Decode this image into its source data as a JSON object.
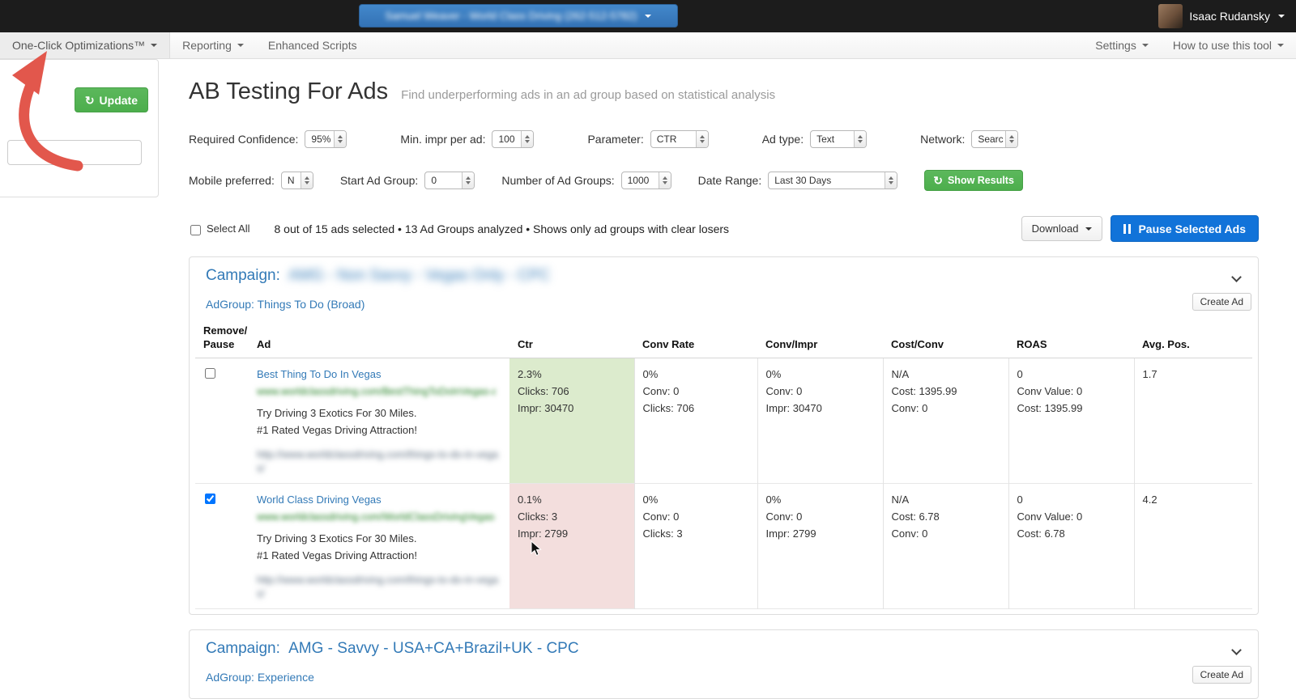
{
  "colors": {
    "accent_green": "#5cb85c",
    "link_blue": "#337ab7",
    "pause_blue": "#1173d9",
    "good_cell_bg": "#dcebcd",
    "bad_cell_bg": "#f3dedd",
    "arrow_red": "#e2574c"
  },
  "topbar": {
    "account_label": "Samuel Weaver - World Class Driving (262-512-5782)",
    "user_name": "Isaac Rudansky"
  },
  "nav": {
    "items": [
      {
        "label": "One-Click Optimizations™"
      },
      {
        "label": "Reporting"
      },
      {
        "label": "Enhanced Scripts"
      }
    ],
    "right_items": [
      {
        "label": "Settings"
      },
      {
        "label": "How to use this tool"
      }
    ]
  },
  "sidebar": {
    "update_label": "Update"
  },
  "page": {
    "title": "AB Testing For Ads",
    "subtitle": "Find underperforming ads in an ad group based on statistical analysis"
  },
  "filters": {
    "row1": [
      {
        "label": "Required Confidence:",
        "value": "95%"
      },
      {
        "label": "Min. impr per ad:",
        "value": "100"
      },
      {
        "label": "Parameter:",
        "value": "CTR"
      },
      {
        "label": "Ad type:",
        "value": "Text"
      },
      {
        "label": "Network:",
        "value": "Searc"
      }
    ],
    "row2": [
      {
        "label": "Mobile preferred:",
        "value": "N"
      },
      {
        "label": "Start Ad Group:",
        "value": "0"
      },
      {
        "label": "Number of Ad Groups:",
        "value": "1000"
      },
      {
        "label": "Date Range:",
        "value": "Last 30 Days"
      }
    ],
    "show_results_label": "Show Results"
  },
  "selection": {
    "select_all_label": "Select All",
    "summary": "8 out of 15 ads selected • 13 Ad Groups analyzed • Shows only ad groups with clear losers",
    "download_label": "Download",
    "pause_label": "Pause Selected Ads"
  },
  "table_headers": {
    "remove_pause": "Remove/\nPause",
    "ad": "Ad",
    "ctr": "Ctr",
    "conv_rate": "Conv Rate",
    "conv_impr": "Conv/Impr",
    "cost_conv": "Cost/Conv",
    "roas": "ROAS",
    "avg_pos": "Avg. Pos."
  },
  "campaigns": [
    {
      "prefix": "Campaign:",
      "name": "AMG - Non Savvy - Vegas Only - CPC",
      "adgroup": "AdGroup: Things To Do (Broad)",
      "create_ad_label": "Create Ad",
      "ads": [
        {
          "checked": false,
          "title": "Best Thing To Do In Vegas",
          "display_url": "www.worldclassdriving.com/BestThingToDoInVegas-attract",
          "desc1": "Try Driving 3 Exotics For 30 Miles.",
          "desc2": "#1 Rated Vegas Driving Attraction!",
          "final_url": "http://www.worldclassdriving.com/things-to-do-in-vegas/",
          "ctr": {
            "tone": "good",
            "lines": [
              "2.3%",
              "Clicks: 706",
              "Impr: 30470"
            ]
          },
          "conv_rate": [
            "0%",
            "Conv: 0",
            "Clicks: 706"
          ],
          "conv_impr": [
            "0%",
            "Conv: 0",
            "Impr: 30470"
          ],
          "cost_conv": [
            "N/A",
            "Cost: 1395.99",
            "Conv: 0"
          ],
          "roas": [
            "0",
            "Conv Value: 0",
            "Cost: 1395.99"
          ],
          "avg_pos": "1.7"
        },
        {
          "checked": true,
          "title": "World Class Driving Vegas",
          "display_url": "www.worldclassdriving.com/WorldClassDrivingVegas-attract",
          "desc1": "Try Driving 3 Exotics For 30 Miles.",
          "desc2": "#1 Rated Vegas Driving Attraction!",
          "final_url": "http://www.worldclassdriving.com/things-to-do-in-vegas/",
          "ctr": {
            "tone": "bad",
            "lines": [
              "0.1%",
              "Clicks: 3",
              "Impr: 2799"
            ]
          },
          "conv_rate": [
            "0%",
            "Conv: 0",
            "Clicks: 3"
          ],
          "conv_impr": [
            "0%",
            "Conv: 0",
            "Impr: 2799"
          ],
          "cost_conv": [
            "N/A",
            "Cost: 6.78",
            "Conv: 0"
          ],
          "roas": [
            "0",
            "Conv Value: 0",
            "Cost: 6.78"
          ],
          "avg_pos": "4.2"
        }
      ]
    },
    {
      "prefix": "Campaign:",
      "name": "AMG - Savvy - USA+CA+Brazil+UK - CPC",
      "adgroup": "AdGroup: Experience",
      "create_ad_label": "Create Ad",
      "ads": []
    }
  ]
}
